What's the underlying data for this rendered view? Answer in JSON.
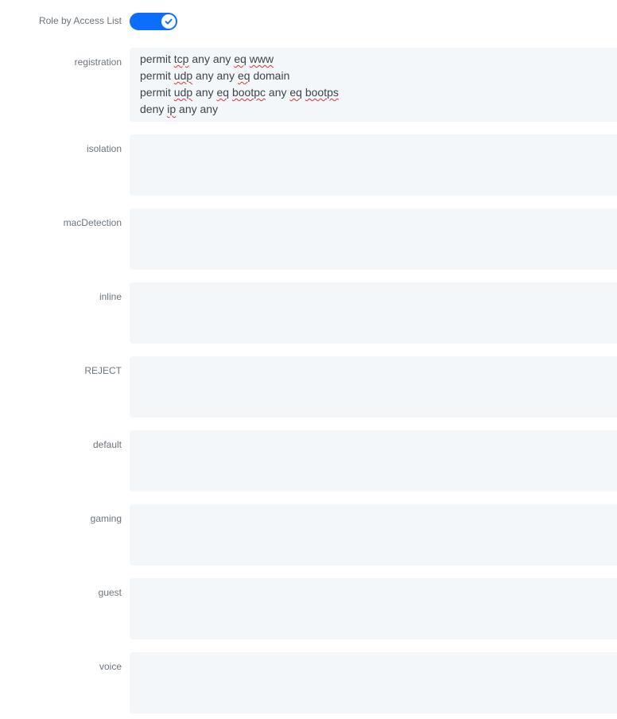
{
  "toggle": {
    "label": "Role by Access List",
    "enabled": true,
    "color": "#0d6efd"
  },
  "roles": [
    {
      "name": "registration",
      "acl_lines": [
        [
          {
            "t": "permit "
          },
          {
            "t": "tcp",
            "sq": true
          },
          {
            "t": " any any "
          },
          {
            "t": "eq",
            "sq": true
          },
          {
            "t": " "
          },
          {
            "t": "www",
            "sq": true
          }
        ],
        [
          {
            "t": "permit "
          },
          {
            "t": "udp",
            "sq": true
          },
          {
            "t": " any any "
          },
          {
            "t": "eq",
            "sq": true
          },
          {
            "t": " domain"
          }
        ],
        [
          {
            "t": "permit "
          },
          {
            "t": "udp",
            "sq": true
          },
          {
            "t": " any "
          },
          {
            "t": "eq",
            "sq": true
          },
          {
            "t": " "
          },
          {
            "t": "bootpc",
            "sq": true
          },
          {
            "t": " any "
          },
          {
            "t": "eq",
            "sq": true
          },
          {
            "t": " "
          },
          {
            "t": "bootps",
            "sq": true
          }
        ],
        [
          {
            "t": "deny "
          },
          {
            "t": "ip",
            "sq": true
          },
          {
            "t": " any any"
          }
        ]
      ]
    },
    {
      "name": "isolation",
      "acl_lines": []
    },
    {
      "name": "macDetection",
      "acl_lines": []
    },
    {
      "name": "inline",
      "acl_lines": []
    },
    {
      "name": "REJECT",
      "acl_lines": []
    },
    {
      "name": "default",
      "acl_lines": []
    },
    {
      "name": "gaming",
      "acl_lines": []
    },
    {
      "name": "guest",
      "acl_lines": []
    },
    {
      "name": "voice",
      "acl_lines": []
    }
  ]
}
